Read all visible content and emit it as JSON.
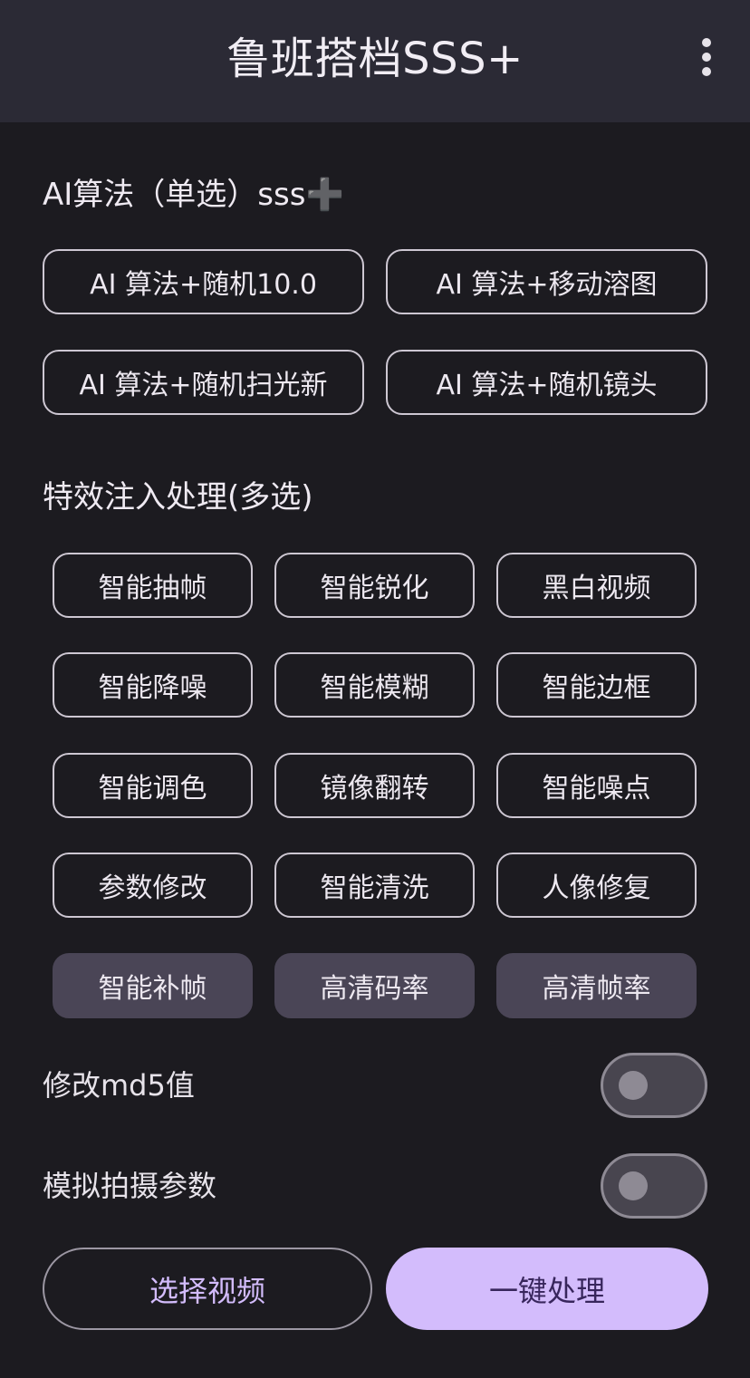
{
  "appbar": {
    "title": "鲁班搭档SSS+",
    "more_icon": "more-vert-icon"
  },
  "ai_section": {
    "title": "AI算法（单选）sss",
    "title_suffix_icon": "plus-icon",
    "options": [
      "AI 算法+随机10.0",
      "AI 算法+移动溶图",
      "AI 算法+随机扫光新",
      "AI 算法+随机镜头"
    ]
  },
  "effects_section": {
    "title": "特效注入处理(多选)",
    "options": [
      "智能抽帧",
      "智能锐化",
      "黑白视频",
      "智能降噪",
      "智能模糊",
      "智能边框",
      "智能调色",
      "镜像翻转",
      "智能噪点",
      "参数修改",
      "智能清洗",
      "人像修复",
      "智能补帧",
      "高清码率",
      "高清帧率"
    ],
    "selected": [
      "智能补帧",
      "高清码率",
      "高清帧率"
    ]
  },
  "toggles": [
    {
      "label": "修改md5值",
      "on": false
    },
    {
      "label": "模拟拍摄参数",
      "on": false
    }
  ],
  "actions": {
    "select_video": "选择视频",
    "one_click_process": "一键处理"
  },
  "colors": {
    "background": "#1c1b20",
    "appbar": "#2b2a35",
    "accent": "#d3bcfc",
    "accent_text": "#38265c",
    "chip_selected": "#4a4556",
    "chip_border": "#cdc7d2"
  }
}
